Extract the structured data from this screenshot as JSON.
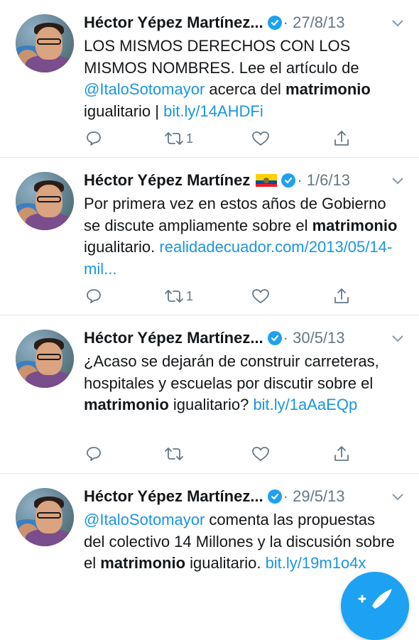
{
  "tweets": [
    {
      "name": "Héctor Yépez Martínez...",
      "date": "· 27/8/13",
      "show_flag": false,
      "body_parts": [
        {
          "t": "LOS MISMOS DERECHOS CON LOS MISMOS NOMBRES. Lee el artículo de ",
          "s": "n"
        },
        {
          "t": "@ItaloSotomayor",
          "s": "l"
        },
        {
          "t": " acerca del ",
          "s": "n"
        },
        {
          "t": "matrimonio",
          "s": "b"
        },
        {
          "t": " igualitario | ",
          "s": "n"
        },
        {
          "t": "bit.ly/14AHDFi",
          "s": "l"
        }
      ],
      "retweet_count": "1"
    },
    {
      "name": "Héctor Yépez Martínez",
      "date": "· 1/6/13",
      "show_flag": true,
      "body_parts": [
        {
          "t": "Por primera vez en estos años de Gobierno se discute ampliamente sobre el ",
          "s": "n"
        },
        {
          "t": "matrimonio",
          "s": "b"
        },
        {
          "t": " igualitario. ",
          "s": "n"
        },
        {
          "t": "realidadecuador.com/2013/05/14-mil...",
          "s": "l"
        }
      ],
      "retweet_count": "1"
    },
    {
      "name": "Héctor Yépez Martínez...",
      "date": "· 30/5/13",
      "show_flag": false,
      "body_parts": [
        {
          "t": "¿Acaso se dejarán de construir carreteras, hospitales y escuelas por discutir sobre el ",
          "s": "n"
        },
        {
          "t": "matrimonio",
          "s": "b"
        },
        {
          "t": " igualitario? ",
          "s": "n"
        },
        {
          "t": "bit.ly/1aAaEQp",
          "s": "l"
        }
      ],
      "retweet_count": ""
    },
    {
      "name": "Héctor Yépez Martínez...",
      "date": "· 29/5/13",
      "show_flag": false,
      "body_parts": [
        {
          "t": "@ItaloSotomayor",
          "s": "l"
        },
        {
          "t": "  comenta las propuestas del colectivo 14 Millones y la discusión sobre el ",
          "s": "n"
        },
        {
          "t": "matrimonio",
          "s": "b"
        },
        {
          "t": " igualitario. ",
          "s": "n"
        },
        {
          "t": "bit.ly/19m1o4x",
          "s": "l"
        }
      ],
      "retweet_count": ""
    }
  ],
  "colors": {
    "link": "#1b95e0",
    "verified": "#1da1f2",
    "muted": "#657786",
    "divider": "#e1e8ed"
  },
  "icons": {
    "verified": "verified-badge-icon",
    "reply": "reply-icon",
    "retweet": "retweet-icon",
    "like": "heart-icon",
    "share": "share-icon",
    "menu": "chevron-down-icon",
    "compose": "compose-tweet-icon"
  }
}
